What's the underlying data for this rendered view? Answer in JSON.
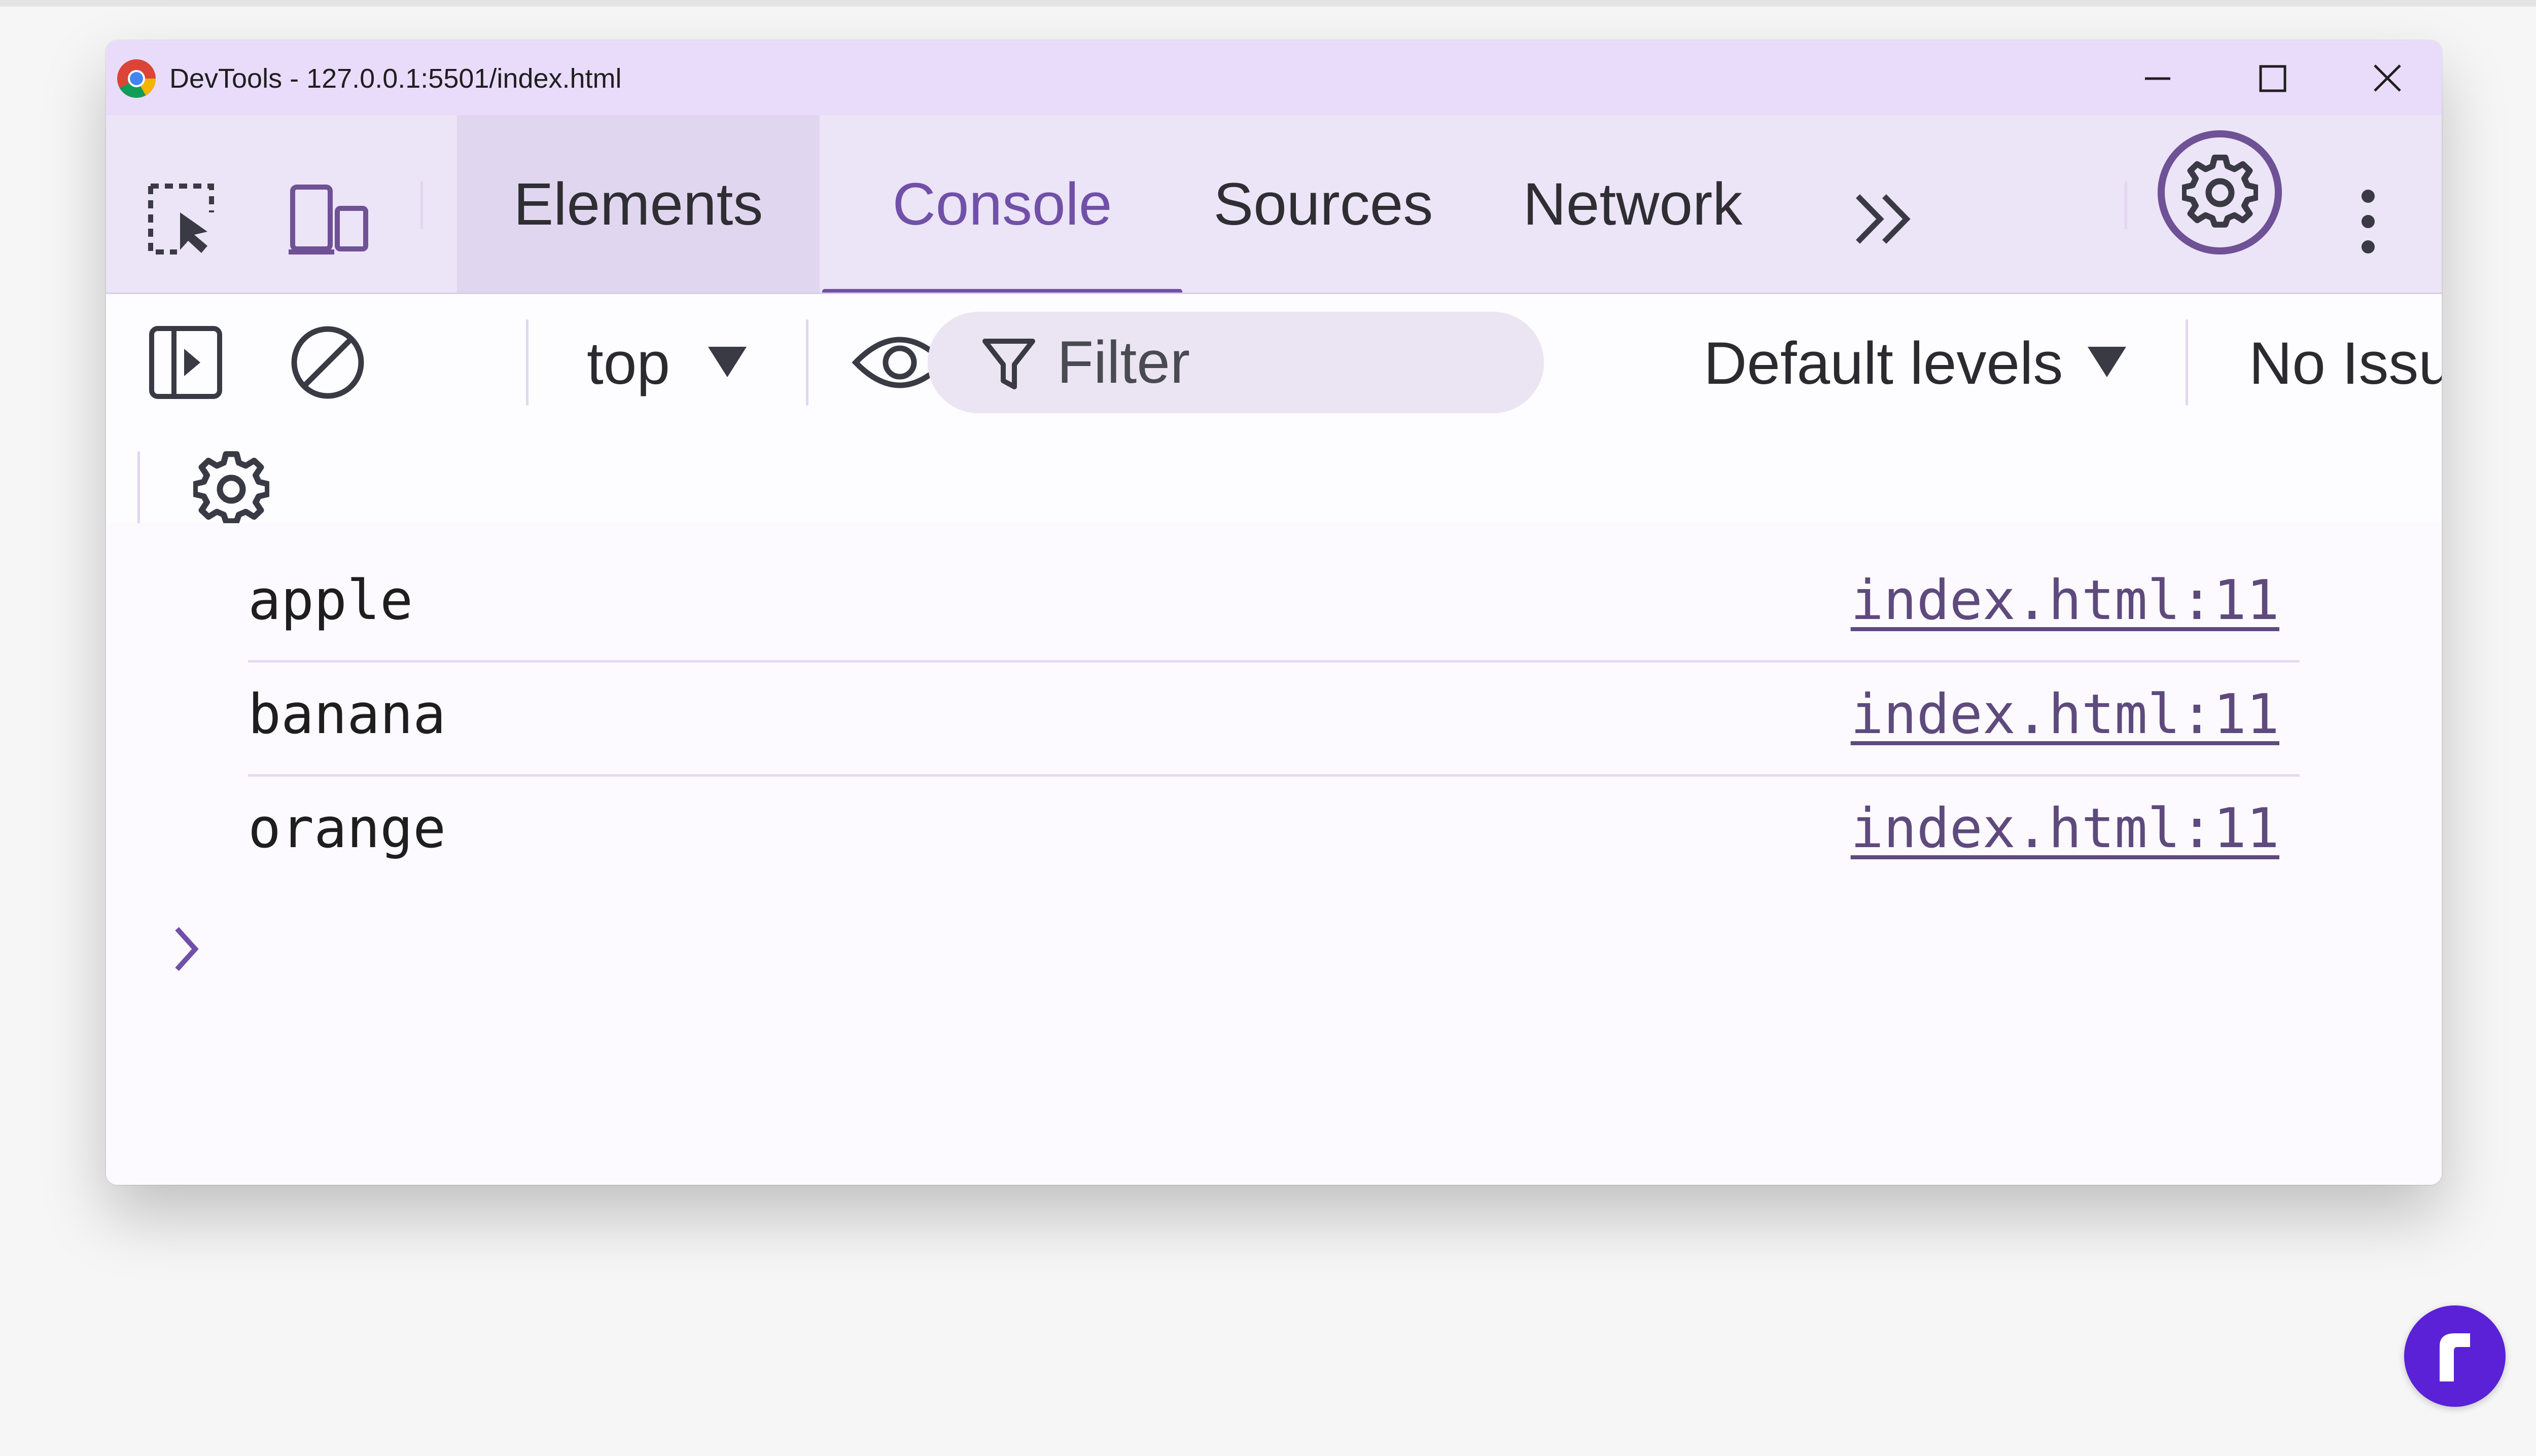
{
  "window": {
    "title": "DevTools - 127.0.0.1:5501/index.html"
  },
  "tabs": [
    {
      "label": "Elements"
    },
    {
      "label": "Console"
    },
    {
      "label": "Sources"
    },
    {
      "label": "Network"
    }
  ],
  "icons": {
    "inspect": "select-element-icon",
    "device": "device-toolbar-icon",
    "more_tabs": "chevron-double-right-icon",
    "settings": "gear-icon",
    "menu": "kebab-menu-icon",
    "sidebar": "show-sidebar-icon",
    "clear": "clear-console-icon",
    "eye": "eye-icon",
    "filter": "filter-icon",
    "console_settings": "gear-icon"
  },
  "toolbar": {
    "context": "top",
    "filter_placeholder": "Filter",
    "levels": "Default levels",
    "issues": "No Issues"
  },
  "console": {
    "messages": [
      {
        "text": "apple",
        "source": "index.html:11"
      },
      {
        "text": "banana",
        "source": "index.html:11"
      },
      {
        "text": "orange",
        "source": "index.html:11"
      }
    ]
  },
  "colors": {
    "accent": "#7050a8",
    "titlebar": "#e9dcfb",
    "tabbar": "#ece4f7",
    "brand": "#5b21d6"
  }
}
